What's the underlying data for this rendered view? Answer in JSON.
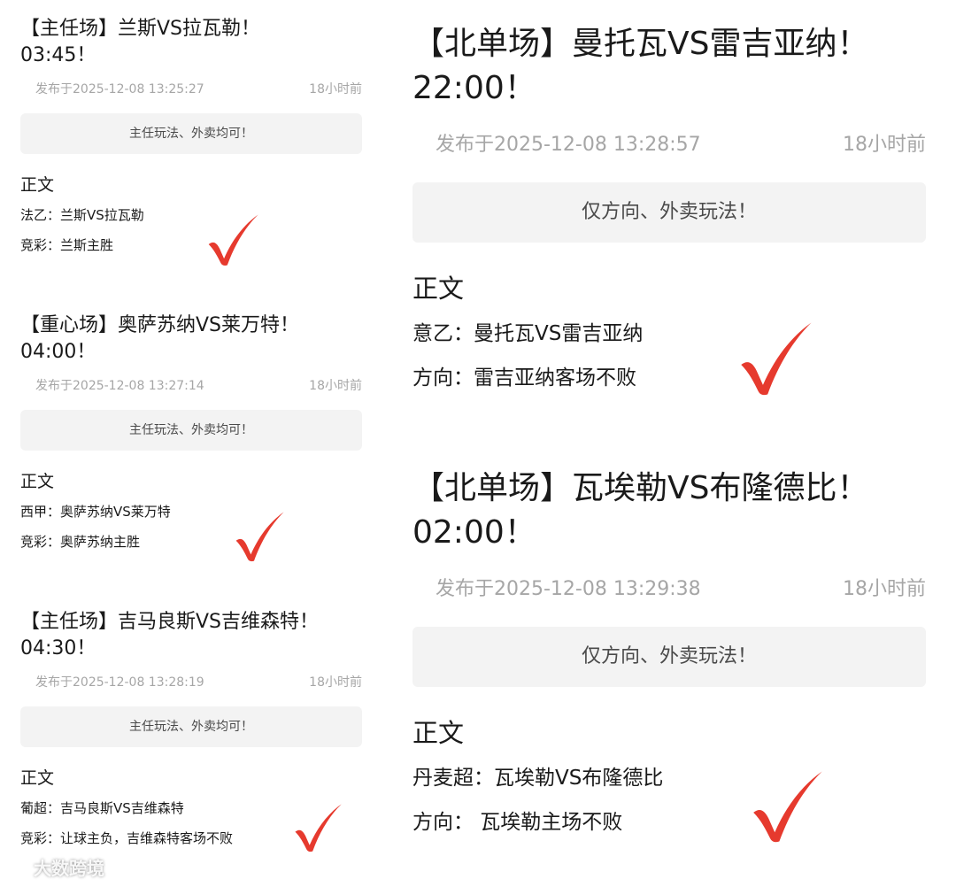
{
  "posts_left": [
    {
      "title_line1": "【主任场】兰斯VS拉瓦勒！",
      "title_line2": "03:45！",
      "published": "发布于2025-12-08 13:25:27",
      "ago": "18小时前",
      "note": "主任玩法、外卖均可！",
      "body_label": "正文",
      "line1": "法乙：兰斯VS拉瓦勒",
      "line2": "竞彩：兰斯主胜"
    },
    {
      "title_line1": "【重心场】奥萨苏纳VS莱万特！",
      "title_line2": "04:00！",
      "published": "发布于2025-12-08 13:27:14",
      "ago": "18小时前",
      "note": "主任玩法、外卖均可！",
      "body_label": "正文",
      "line1": "西甲：奥萨苏纳VS莱万特",
      "line2": "竞彩：奥萨苏纳主胜"
    },
    {
      "title_line1": "【主任场】吉马良斯VS吉维森特！",
      "title_line2": "04:30！",
      "published": "发布于2025-12-08 13:28:19",
      "ago": "18小时前",
      "note": "主任玩法、外卖均可！",
      "body_label": "正文",
      "line1": "葡超：吉马良斯VS吉维森特",
      "line2": "竞彩：让球主负，吉维森特客场不败"
    }
  ],
  "posts_right": [
    {
      "title_line1": "【北单场】曼托瓦VS雷吉亚纳！",
      "title_line2": "22:00！",
      "published": "发布于2025-12-08 13:28:57",
      "ago": "18小时前",
      "note": "仅方向、外卖玩法！",
      "body_label": "正文",
      "line1": "意乙：曼托瓦VS雷吉亚纳",
      "line2": "方向：雷吉亚纳客场不败"
    },
    {
      "title_line1": "【北单场】瓦埃勒VS布隆德比！",
      "title_line2": "02:00！",
      "published": "发布于2025-12-08 13:29:38",
      "ago": "18小时前",
      "note": "仅方向、外卖玩法！",
      "body_label": "正文",
      "line1": "丹麦超：瓦埃勒VS布隆德比",
      "line2": "方向： 瓦埃勒主场不败"
    }
  ],
  "check_icon": "red-checkmark-icon",
  "check_color": "#e63a2e",
  "watermark": {
    "icon": "weibo-icon",
    "text": "大数跨境"
  }
}
